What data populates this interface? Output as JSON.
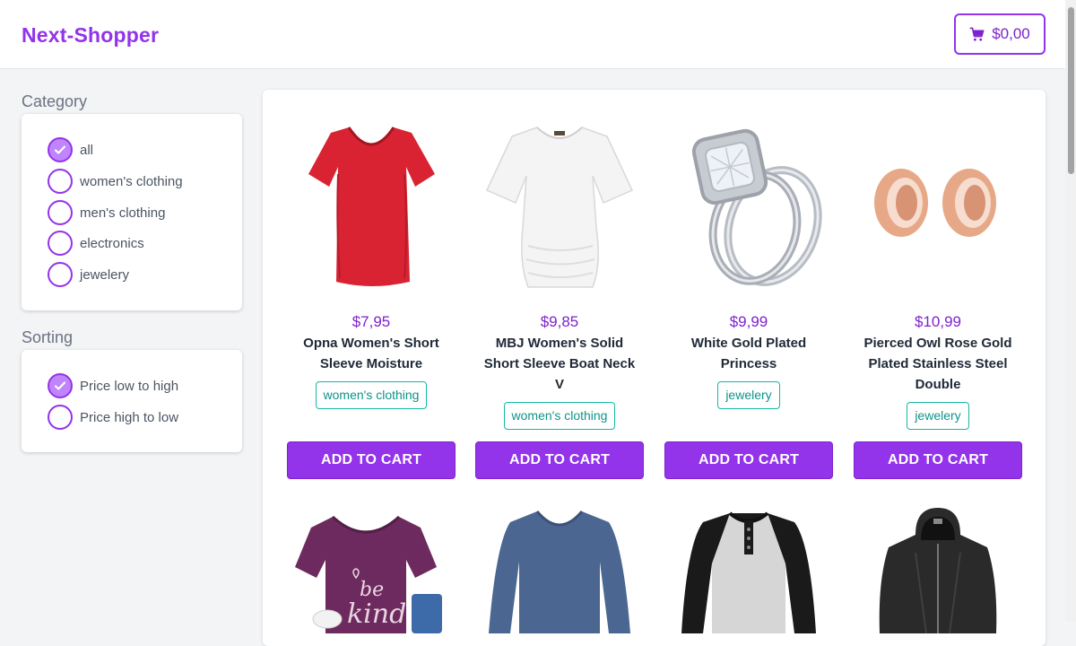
{
  "header": {
    "brand": "Next-Shopper",
    "cart_total": "$0,00"
  },
  "sidebar": {
    "category_title": "Category",
    "categories": [
      {
        "label": "all",
        "checked": true
      },
      {
        "label": "women's clothing",
        "checked": false
      },
      {
        "label": "men's clothing",
        "checked": false
      },
      {
        "label": "electronics",
        "checked": false
      },
      {
        "label": "jewelery",
        "checked": false
      }
    ],
    "sorting_title": "Sorting",
    "sorting": [
      {
        "label": "Price low to high",
        "checked": true
      },
      {
        "label": "Price high to low",
        "checked": false
      }
    ]
  },
  "products": [
    {
      "price": "$7,95",
      "name": "Opna Women's Short Sleeve Moisture",
      "category": "women's clothing",
      "button": "ADD TO CART"
    },
    {
      "price": "$9,85",
      "name": "MBJ Women's Solid Short Sleeve Boat Neck V",
      "category": "women's clothing",
      "button": "ADD TO CART"
    },
    {
      "price": "$9,99",
      "name": "White Gold Plated Princess",
      "category": "jewelery",
      "button": "ADD TO CART"
    },
    {
      "price": "$10,99",
      "name": "Pierced Owl Rose Gold Plated Stainless Steel Double",
      "category": "jewelery",
      "button": "ADD TO CART"
    }
  ],
  "colors": {
    "accent": "#9333ea",
    "tag": "#14b8a6"
  }
}
